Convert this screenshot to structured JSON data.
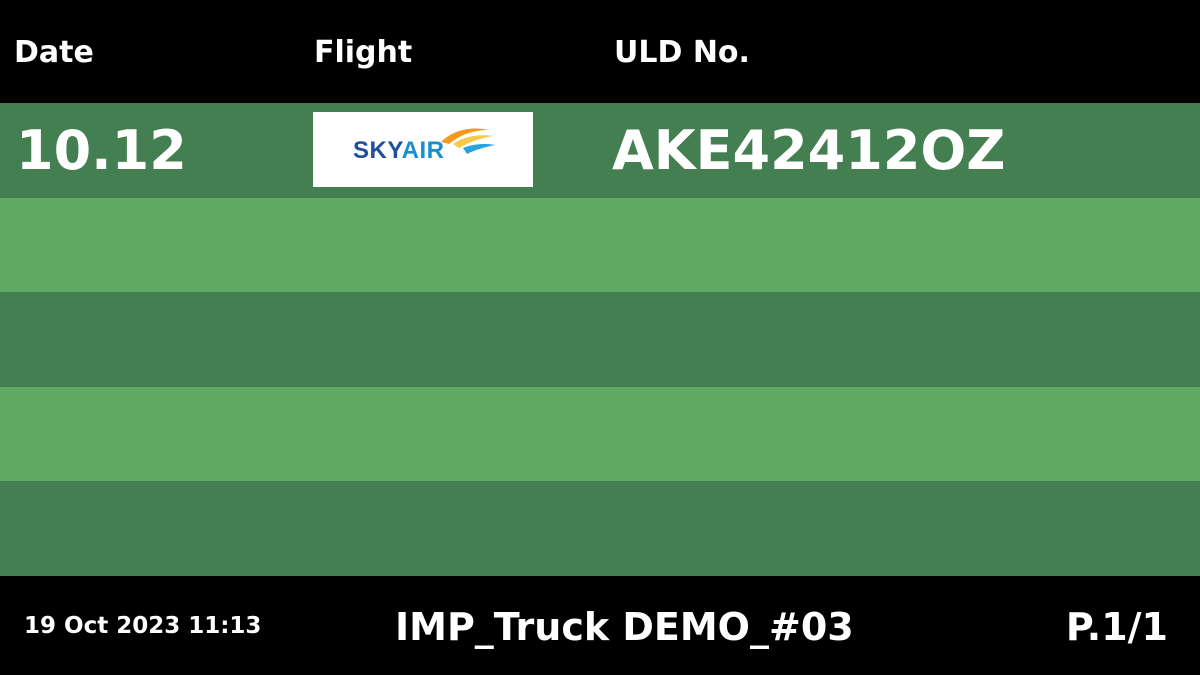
{
  "header": {
    "columns": [
      "Date",
      "Flight",
      "ULD No."
    ]
  },
  "rows": [
    {
      "date": "10.12",
      "flight_logo": {
        "label": "SKYAIR",
        "part_a": "SKY",
        "part_b": "AIR",
        "icon": "skyair-logo-icon",
        "colors": {
          "text_dark": "#1f4e9d",
          "text_light": "#1a8fcf",
          "swoosh_orange": "#f39a1e",
          "swoosh_yellow": "#f7c948",
          "swoosh_blue": "#2aa3dc"
        }
      },
      "uld": "AKE42412OZ"
    },
    {
      "date": "",
      "flight_logo": null,
      "uld": ""
    },
    {
      "date": "",
      "flight_logo": null,
      "uld": ""
    },
    {
      "date": "",
      "flight_logo": null,
      "uld": ""
    },
    {
      "date": "",
      "flight_logo": null,
      "uld": ""
    }
  ],
  "footer": {
    "timestamp": "19 Oct 2023 11:13",
    "title": "IMP_Truck DEMO_#03",
    "page": "P.1/1"
  },
  "colors": {
    "background": "#000000",
    "row_dark": "#437f51",
    "row_light": "#5fab65",
    "text": "#ffffff"
  }
}
